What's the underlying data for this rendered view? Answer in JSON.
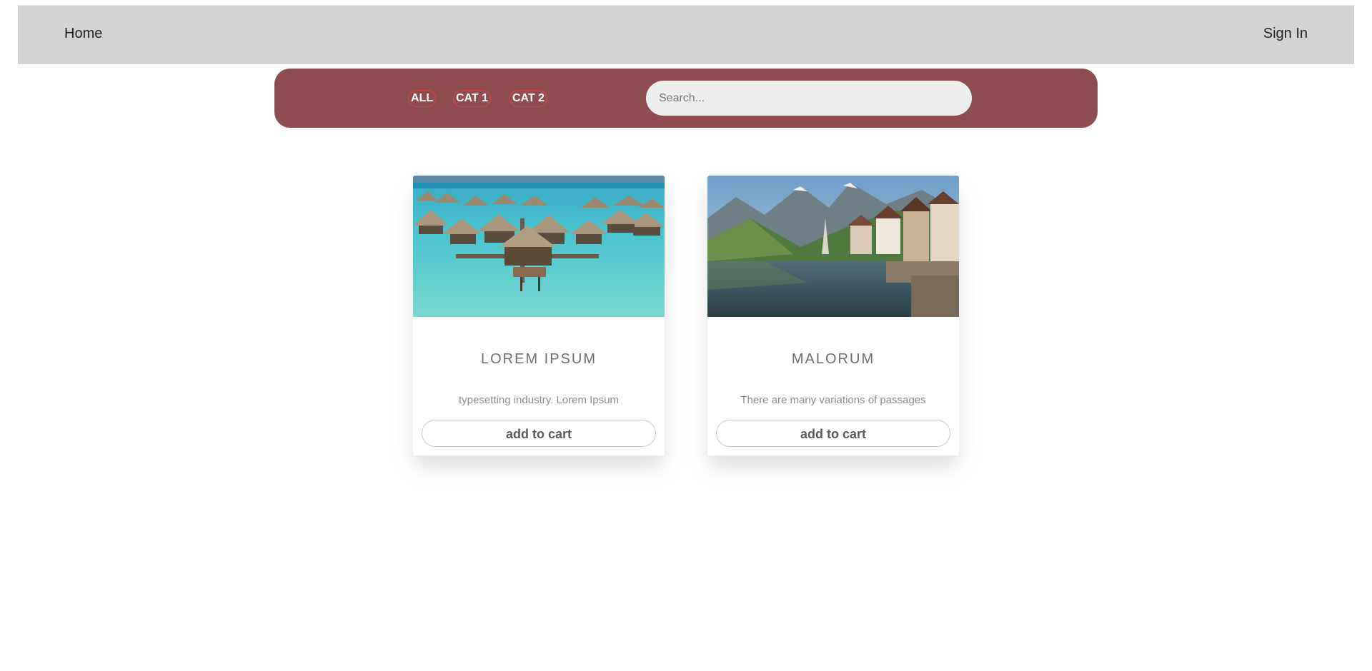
{
  "nav": {
    "home_label": "Home",
    "signin_label": "Sign In"
  },
  "filters": {
    "categories": [
      "ALL",
      "CAT 1",
      "CAT 2"
    ],
    "search_placeholder": "Search..."
  },
  "products": [
    {
      "title": "LOREM IPSUM",
      "description": "typesetting industry. Lorem Ipsum",
      "button_label": "add to cart",
      "image": "overwater-bungalows-photo"
    },
    {
      "title": "MALORUM",
      "description": "There are many variations of passages",
      "button_label": "add to cart",
      "image": "lakeside-village-photo"
    }
  ],
  "colors": {
    "nav_bg": "#d3d3d3",
    "filter_bar_bg": "#8e4d4e",
    "category_border": "#d9473f",
    "search_bg": "#eeeeee"
  }
}
